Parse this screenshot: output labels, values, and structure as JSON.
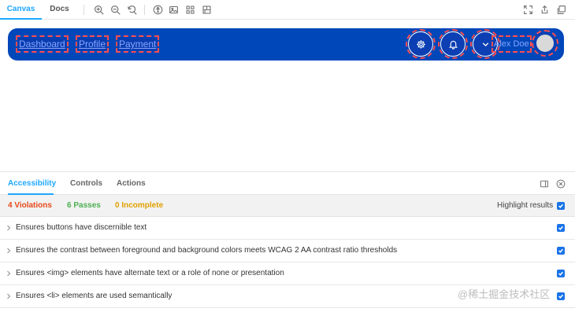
{
  "toolbar": {
    "tabs": [
      "Canvas",
      "Docs"
    ],
    "active_tab": "Canvas",
    "icons": [
      "zoom-in-icon",
      "zoom-out-icon",
      "zoom-reset-icon",
      "accessibility-icon",
      "background-image-icon",
      "grid-icon",
      "measure-icon",
      "fullscreen-icon",
      "share-icon",
      "copy-link-icon"
    ]
  },
  "preview": {
    "nav_links": [
      "Dashboard",
      "Profile",
      "Payment"
    ],
    "user_name": "Alex Doe",
    "buttons": [
      "settings-icon",
      "bell-icon",
      "chevron-down-icon"
    ],
    "colors": {
      "navbar": "#0047ba",
      "highlight": "#ff4d4f"
    }
  },
  "panel": {
    "tabs": [
      "Accessibility",
      "Controls",
      "Actions"
    ],
    "active_tab": "Accessibility",
    "summary": {
      "violations": "4 Violations",
      "passes": "6 Passes",
      "incomplete": "0 Incomplete"
    },
    "highlight_label": "Highlight results",
    "rules": [
      "Ensures buttons have discernible text",
      "Ensures the contrast between foreground and background colors meets WCAG 2 AA contrast ratio thresholds",
      "Ensures <img> elements have alternate text or a role of none or presentation",
      "Ensures <li> elements are used semantically"
    ]
  },
  "watermark": "@稀土掘金技术社区"
}
